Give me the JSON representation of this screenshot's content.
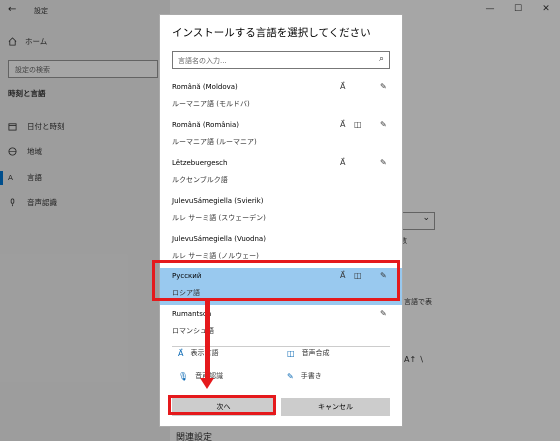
{
  "background": {
    "window_title": "設定",
    "back_glyph": "←",
    "home_label": "ホーム",
    "search_placeholder": "設定の検索",
    "section_title": "時刻と言語",
    "nav_items": [
      {
        "label": "日付と時刻",
        "icon": "calendar-clock-icon"
      },
      {
        "label": "地域",
        "icon": "globe-icon"
      },
      {
        "label": "言語",
        "icon": "language-icon"
      },
      {
        "label": "音声認識",
        "icon": "microphone-icon"
      }
    ],
    "window_controls": {
      "minimize": "—",
      "maximize": "☐",
      "close": "✕"
    },
    "fragment_1": "数",
    "fragment_2": "言語で表",
    "fragment_3": "A↑ ∖",
    "related_title": "関連設定"
  },
  "dialog": {
    "title": "インストールする言語を選択してください",
    "search_placeholder": "言語名の入力...",
    "languages": [
      {
        "name": "Română (Moldova)",
        "native": "ルーマニア語 (モルドバ)",
        "display": true,
        "tts": false,
        "handwriting": true,
        "selected": false
      },
      {
        "name": "Română (România)",
        "native": "ルーマニア語 (ルーマニア)",
        "display": true,
        "tts": true,
        "handwriting": true,
        "selected": false
      },
      {
        "name": "Lëtzebuergesch",
        "native": "ルクセンブルク語",
        "display": true,
        "tts": false,
        "handwriting": true,
        "selected": false
      },
      {
        "name": "JulevuSámegiella (Svierik)",
        "native": "ルレ サーミ語 (スウェーデン)",
        "display": false,
        "tts": false,
        "handwriting": false,
        "selected": false
      },
      {
        "name": "JulevuSámegiella (Vuodna)",
        "native": "ルレ サーミ語 (ノルウェー)",
        "display": false,
        "tts": false,
        "handwriting": false,
        "selected": false
      },
      {
        "name": "Русский",
        "native": "ロシア語",
        "display": true,
        "tts": true,
        "handwriting": true,
        "selected": true
      },
      {
        "name": "Rumantsch",
        "native": "ロマンシュ語",
        "display": false,
        "tts": false,
        "handwriting": true,
        "selected": false
      }
    ],
    "legend": {
      "display_language": "表示言語",
      "tts": "音声合成",
      "speech_recognition": "音声認識",
      "handwriting": "手書き"
    },
    "buttons": {
      "next": "次へ",
      "cancel": "キャンセル"
    }
  },
  "colors": {
    "selection": "#99c9ef",
    "annotation_red": "#e5191c",
    "accent": "#0078d7"
  }
}
